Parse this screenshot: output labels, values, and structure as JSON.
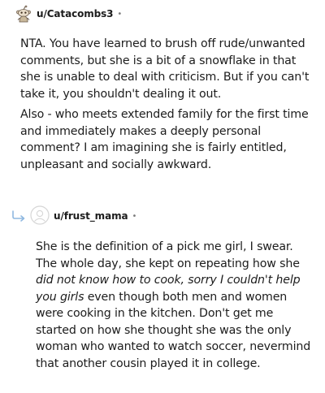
{
  "comments": [
    {
      "author": "u/Catacombs3",
      "separator": "•",
      "avatar_icon": "snoo-avatar-icon",
      "paragraphs": [
        "NTA. You have learned to brush off rude/unwanted comments, but she is a bit of a snowflake in that she is unable to deal with criticism. But if you can't take it, you shouldn't dealing it out.",
        "Also - who meets extended family for the first time and immediately makes a deeply personal comment? I am imagining she is fairly entitled, unpleasant and socially awkward."
      ]
    }
  ],
  "reply": {
    "author": "u/frust_mama",
    "separator": "•",
    "reply_icon": "reply-arrow-icon",
    "avatar_icon": "default-avatar-icon",
    "text_before": "She is the definition of a pick me girl, I swear. The whole day, she kept on repeating how she ",
    "text_italic": "did not know how to cook, sorry I couldn't help you girls",
    "text_after": " even though both men and women were cooking in the kitchen. Don't get me started on how she thought she was the only woman who wanted to watch soccer, nevermind that another cousin played it in college."
  },
  "colors": {
    "text": "#1c1c1c",
    "meta": "#7c7c7c",
    "reply_arrow": "#8fb8e0"
  }
}
